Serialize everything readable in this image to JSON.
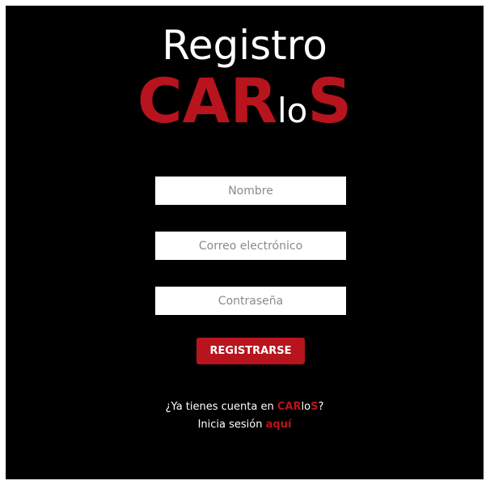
{
  "page": {
    "title": "Registro",
    "brand": {
      "part1": "CAR",
      "part2": "lo",
      "part3": "S"
    }
  },
  "form": {
    "name_placeholder": "Nombre",
    "email_placeholder": "Correo electrónico",
    "password_placeholder": "Contraseña",
    "submit_label": "REGISTRARSE"
  },
  "footer": {
    "question_prefix": "¿Ya tienes cuenta en ",
    "question_suffix": "?",
    "login_prefix": "Inicia sesión ",
    "login_link": "aquí"
  },
  "colors": {
    "accent": "#b8141e",
    "background": "#000000",
    "text": "#ffffff"
  }
}
